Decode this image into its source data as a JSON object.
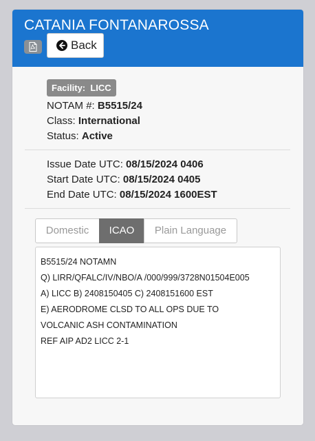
{
  "header": {
    "title": "CATANIA FONTANAROSSA",
    "pdf_icon": "pdf-file-icon",
    "back_label": "Back",
    "back_icon": "arrow-left-circle-icon",
    "accent": "#1b75cf"
  },
  "facility": {
    "label": "Facility:",
    "value": "LICC"
  },
  "notam_info": {
    "notam_label": "NOTAM #:",
    "notam_value": "B5515/24",
    "class_label": "Class:",
    "class_value": "International",
    "status_label": "Status:",
    "status_value": "Active"
  },
  "dates": {
    "issue_label": "Issue Date UTC:",
    "issue_value": "08/15/2024 0406",
    "start_label": "Start Date UTC:",
    "start_value": "08/15/2024 0405",
    "end_label": "End Date UTC:",
    "end_value": "08/15/2024 1600EST"
  },
  "tabs": [
    {
      "label": "Domestic",
      "active": false
    },
    {
      "label": "ICAO",
      "active": true
    },
    {
      "label": "Plain Language",
      "active": false
    }
  ],
  "notam_text": [
    "B5515/24 NOTAMN",
    "Q) LIRR/QFALC/IV/NBO/A /000/999/3728N01504E005",
    "A) LICC B) 2408150405 C) 2408151600 EST",
    "E) AERODROME CLSD TO ALL OPS DUE TO",
    "VOLCANIC ASH CONTAMINATION",
    "REF AIP AD2 LICC 2-1"
  ]
}
